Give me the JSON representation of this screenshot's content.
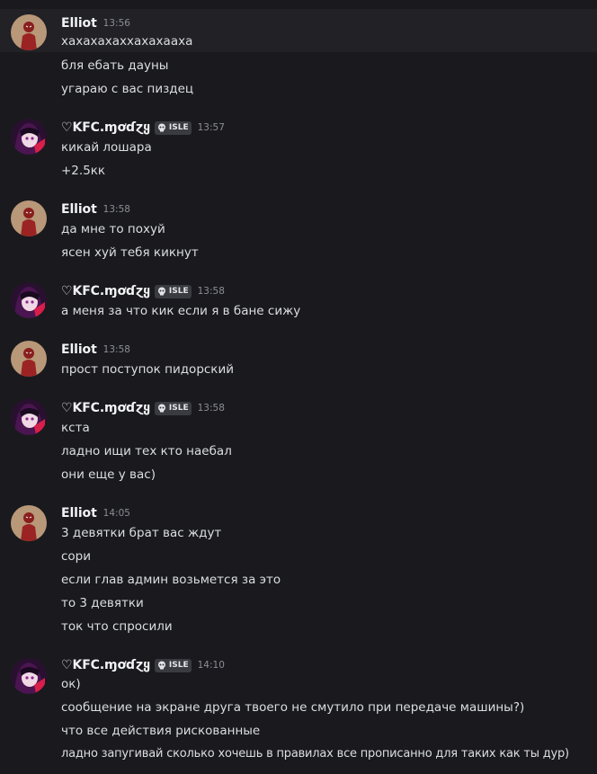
{
  "groups": [
    {
      "author": "Elliot",
      "time": "13:56",
      "avatar": "spiderman-avatar",
      "tag": null,
      "lines": [
        "хахахахаххахахааха",
        "бля ебать дауны",
        "угараю с вас пиздец"
      ]
    },
    {
      "author": "♡KFC.ɱơɗɀყ",
      "time": "13:57",
      "avatar": "anime-avatar",
      "tag": "ISLE",
      "lines": [
        "кикай лошара",
        "+2.5кк"
      ]
    },
    {
      "author": "Elliot",
      "time": "13:58",
      "avatar": "spiderman-avatar",
      "tag": null,
      "lines": [
        "да мне то похуй",
        "ясен хуй тебя кикнут"
      ]
    },
    {
      "author": "♡KFC.ɱơɗɀყ",
      "time": "13:58",
      "avatar": "anime-avatar",
      "tag": "ISLE",
      "lines": [
        "а меня за что кик если я в бане сижу"
      ]
    },
    {
      "author": "Elliot",
      "time": "13:58",
      "avatar": "spiderman-avatar",
      "tag": null,
      "lines": [
        "прост поступок пидорский"
      ]
    },
    {
      "author": "♡KFC.ɱơɗɀყ",
      "time": "13:58",
      "avatar": "anime-avatar",
      "tag": "ISLE",
      "lines": [
        "кста",
        "ладно ищи тех кто наебал",
        "они еще у вас)"
      ]
    },
    {
      "author": "Elliot",
      "time": "14:05",
      "avatar": "spiderman-avatar",
      "tag": null,
      "lines": [
        "3 девятки брат вас ждут",
        "сори",
        "если глав админ возьмется за это",
        "то 3 девятки",
        "ток что спросили"
      ]
    },
    {
      "author": "♡KFC.ɱơɗɀყ",
      "time": "14:10",
      "avatar": "anime-avatar",
      "tag": "ISLE",
      "lines": [
        "ок)",
        "сообщение на экране друга твоего не смутило при передаче машины?)",
        "что все действия рискованные",
        "ладно запугивай сколько хочешь в правилах все прописанно для таких как ты дур)"
      ]
    }
  ]
}
